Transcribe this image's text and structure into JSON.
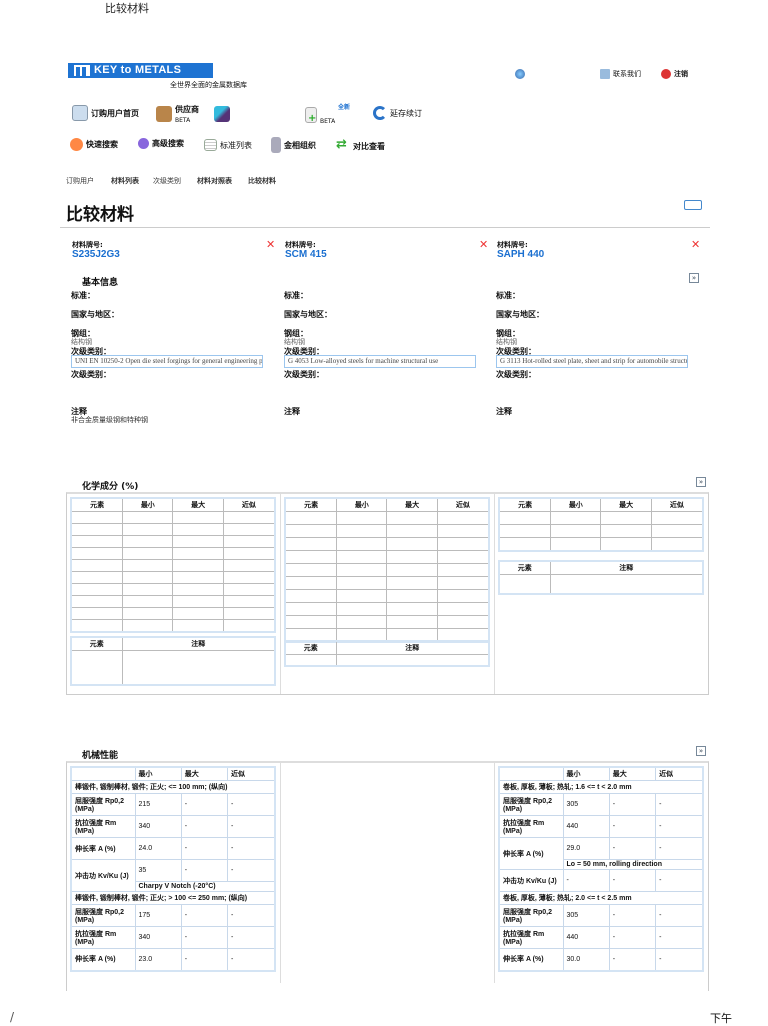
{
  "window_title": "比较材料",
  "header": {
    "logo": "KEY to METALS",
    "tagline": "全世界全面的金属数据库",
    "contact": "联系我们",
    "logout": "注销"
  },
  "nav": {
    "row1": [
      {
        "label": "订购用户首页"
      },
      {
        "label": "供应商",
        "badge": "BETA"
      },
      {
        "label": ""
      },
      {
        "label": "",
        "new": "全新",
        "badge": "BETA"
      },
      {
        "label": "延存续订"
      }
    ],
    "row2": [
      {
        "label": "快速搜索"
      },
      {
        "label": "高级搜索"
      },
      {
        "label": "标准列表"
      },
      {
        "label": "金相组织"
      },
      {
        "label": "对比查看"
      }
    ]
  },
  "breadcrumb": [
    "订购用户",
    "材料列表",
    "次级类别",
    "材料对照表",
    "比较材料"
  ],
  "page_title": "比较材料",
  "materials": [
    {
      "label": "材料牌号:",
      "name": "S235J2G3",
      "standard": "标准：",
      "country": "国家与地区：",
      "group": "钢组：",
      "group_value": "结构钢",
      "subcat": "次级类别：",
      "subcat_value": "UNI EN 10250-2 Open die steel forgings for general engineering p",
      "subcat2": "次级类别：",
      "notes": "注释",
      "notes_value": "非合金质量级钢和特种钢"
    },
    {
      "label": "材料牌号:",
      "name": "SCM 415",
      "standard": "标准：",
      "country": "国家与地区：",
      "group": "钢组：",
      "group_value": "结构钢",
      "subcat": "次级类别：",
      "subcat_value": "G 4053 Low-alloyed steels for machine structural use",
      "subcat2": "次级类别：",
      "notes": "注释",
      "notes_value": ""
    },
    {
      "label": "材料牌号:",
      "name": "SAPH 440",
      "standard": "标准：",
      "country": "国家与地区：",
      "group": "钢组：",
      "group_value": "结构钢",
      "subcat": "次级类别：",
      "subcat_value": "G 3113 Hot-rolled steel plate, sheet and strip for automobile structu",
      "subcat2": "次级类别：",
      "notes": "注释",
      "notes_value": ""
    }
  ],
  "sections": {
    "basic": "基本信息",
    "chem": "化学成分 (%)",
    "mech": "机械性能"
  },
  "chem_headers": [
    "元素",
    "最小",
    "最大",
    "近似"
  ],
  "chem_note_headers": [
    "元素",
    "注释"
  ],
  "mech_headers": [
    "",
    "最小",
    "最大",
    "近似"
  ],
  "mech_left": [
    {
      "group": "棒锻件, 锻制棒材, 锻件; 正火; <= 100 mm; (纵向)"
    },
    {
      "label": "屈服强度 Rp0,2 (MPa)",
      "min": "215",
      "max": "-",
      "approx": "-"
    },
    {
      "label": "抗拉强度 Rm (MPa)",
      "min": "340",
      "max": "-",
      "approx": "-"
    },
    {
      "label": "伸长率 A (%)",
      "min": "24.0",
      "max": "-",
      "approx": "-"
    },
    {
      "label": "冲击功 Kv/Ku (J)",
      "min": "35",
      "max": "-",
      "approx": "-",
      "note": "Charpy V Notch (-20°C)"
    },
    {
      "group": "棒锻件, 锻制棒材, 锻件; 正火; > 100 <= 250 mm; (纵向)"
    },
    {
      "label": "屈服强度 Rp0,2 (MPa)",
      "min": "175",
      "max": "-",
      "approx": "-"
    },
    {
      "label": "抗拉强度 Rm (MPa)",
      "min": "340",
      "max": "-",
      "approx": "-"
    },
    {
      "label": "伸长率 A (%)",
      "min": "23.0",
      "max": "-",
      "approx": "-"
    }
  ],
  "mech_right": [
    {
      "group": "卷板, 厚板, 薄板; 热轧; 1.6 <= t < 2.0 mm"
    },
    {
      "label": "屈服强度 Rp0,2 (MPa)",
      "min": "305",
      "max": "-",
      "approx": "-"
    },
    {
      "label": "抗拉强度 Rm (MPa)",
      "min": "440",
      "max": "-",
      "approx": "-"
    },
    {
      "label": "伸长率 A (%)",
      "min": "29.0",
      "max": "-",
      "approx": "-",
      "note": "Lo = 50 mm, rolling direction"
    },
    {
      "label": "冲击功 Kv/Ku (J)",
      "min": "-",
      "max": "-",
      "approx": "-"
    },
    {
      "group": "卷板, 厚板, 薄板; 热轧; 2.0 <= t < 2.5 mm"
    },
    {
      "label": "屈服强度 Rp0,2 (MPa)",
      "min": "305",
      "max": "-",
      "approx": "-"
    },
    {
      "label": "抗拉强度 Rm (MPa)",
      "min": "440",
      "max": "-",
      "approx": "-"
    },
    {
      "label": "伸长率 A (%)",
      "min": "30.0",
      "max": "-",
      "approx": "-"
    }
  ],
  "taskbar": {
    "clock": "下午"
  }
}
